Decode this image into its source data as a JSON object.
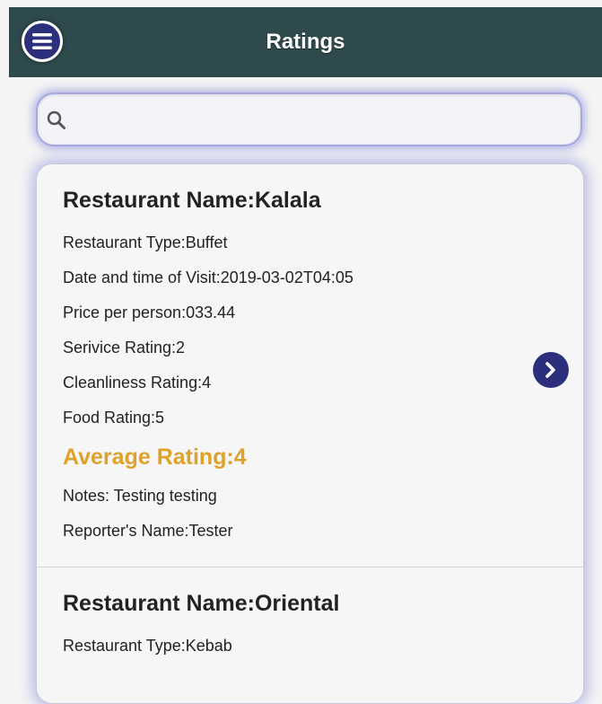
{
  "header": {
    "title": "Ratings",
    "menu_icon": "hamburger-menu-icon"
  },
  "search": {
    "placeholder": "",
    "value": "",
    "icon": "search-icon"
  },
  "ratings": [
    {
      "name": "Restaurant Name:Kalala",
      "type": "Restaurant Type:Buffet",
      "visit": "Date and time of Visit:2019-03-02T04:05",
      "price": "Price per person:033.44",
      "service": "Serivice Rating:2",
      "cleanliness": "Cleanliness Rating:4",
      "food": "Food Rating:5",
      "average": "Average Rating:4",
      "notes": "Notes: Testing testing",
      "reporter": "Reporter's Name:Tester"
    },
    {
      "name": "Restaurant Name:Oriental",
      "type": "Restaurant Type:Kebab"
    }
  ],
  "colors": {
    "header_bg": "#2f4a4d",
    "accent": "#2b2f7c",
    "average_rating": "#e0a12a",
    "glow": "#6e70d7"
  }
}
